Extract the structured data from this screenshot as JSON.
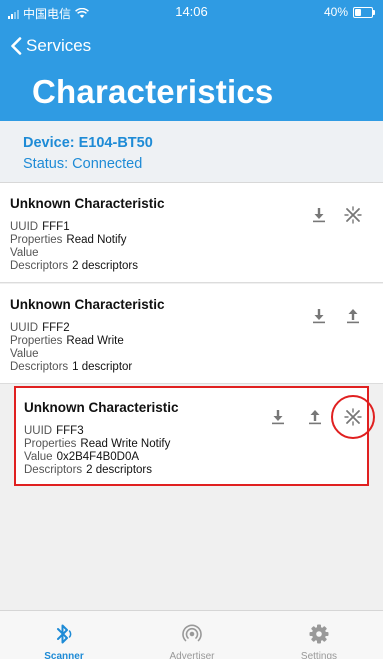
{
  "status_bar": {
    "carrier": "中国电信",
    "time": "14:06",
    "battery_text": "40%",
    "battery_level": 0.4
  },
  "nav": {
    "back_label": "Services",
    "title": "Characteristics"
  },
  "device": {
    "name_label": "Device:",
    "name": "E104-BT50",
    "status_label": "Status:",
    "status": "Connected"
  },
  "field_labels": {
    "uuid": "UUID",
    "properties": "Properties",
    "value": "Value",
    "descriptors": "Descriptors"
  },
  "characteristics": [
    {
      "title": "Unknown Characteristic",
      "uuid": "FFF1",
      "properties": "Read Notify",
      "value": "",
      "descriptors": "2 descriptors",
      "actions": [
        "read",
        "notify"
      ]
    },
    {
      "title": "Unknown Characteristic",
      "uuid": "FFF2",
      "properties": "Read Write",
      "value": "",
      "descriptors": "1 descriptor",
      "actions": [
        "read",
        "write"
      ]
    },
    {
      "title": "Unknown Characteristic",
      "uuid": "FFF3",
      "properties": "Read Write Notify",
      "value": "0x2B4F4B0D0A",
      "descriptors": "2 descriptors",
      "actions": [
        "read",
        "write",
        "notify"
      ]
    }
  ],
  "tabs": [
    {
      "label": "Scanner",
      "icon": "bluetooth-icon",
      "active": true
    },
    {
      "label": "Advertiser",
      "icon": "broadcast-icon",
      "active": false
    },
    {
      "label": "Settings",
      "icon": "gear-icon",
      "active": false
    }
  ],
  "colors": {
    "header": "#2f9be3",
    "accent": "#1e8bd6",
    "highlight": "#e02020"
  }
}
